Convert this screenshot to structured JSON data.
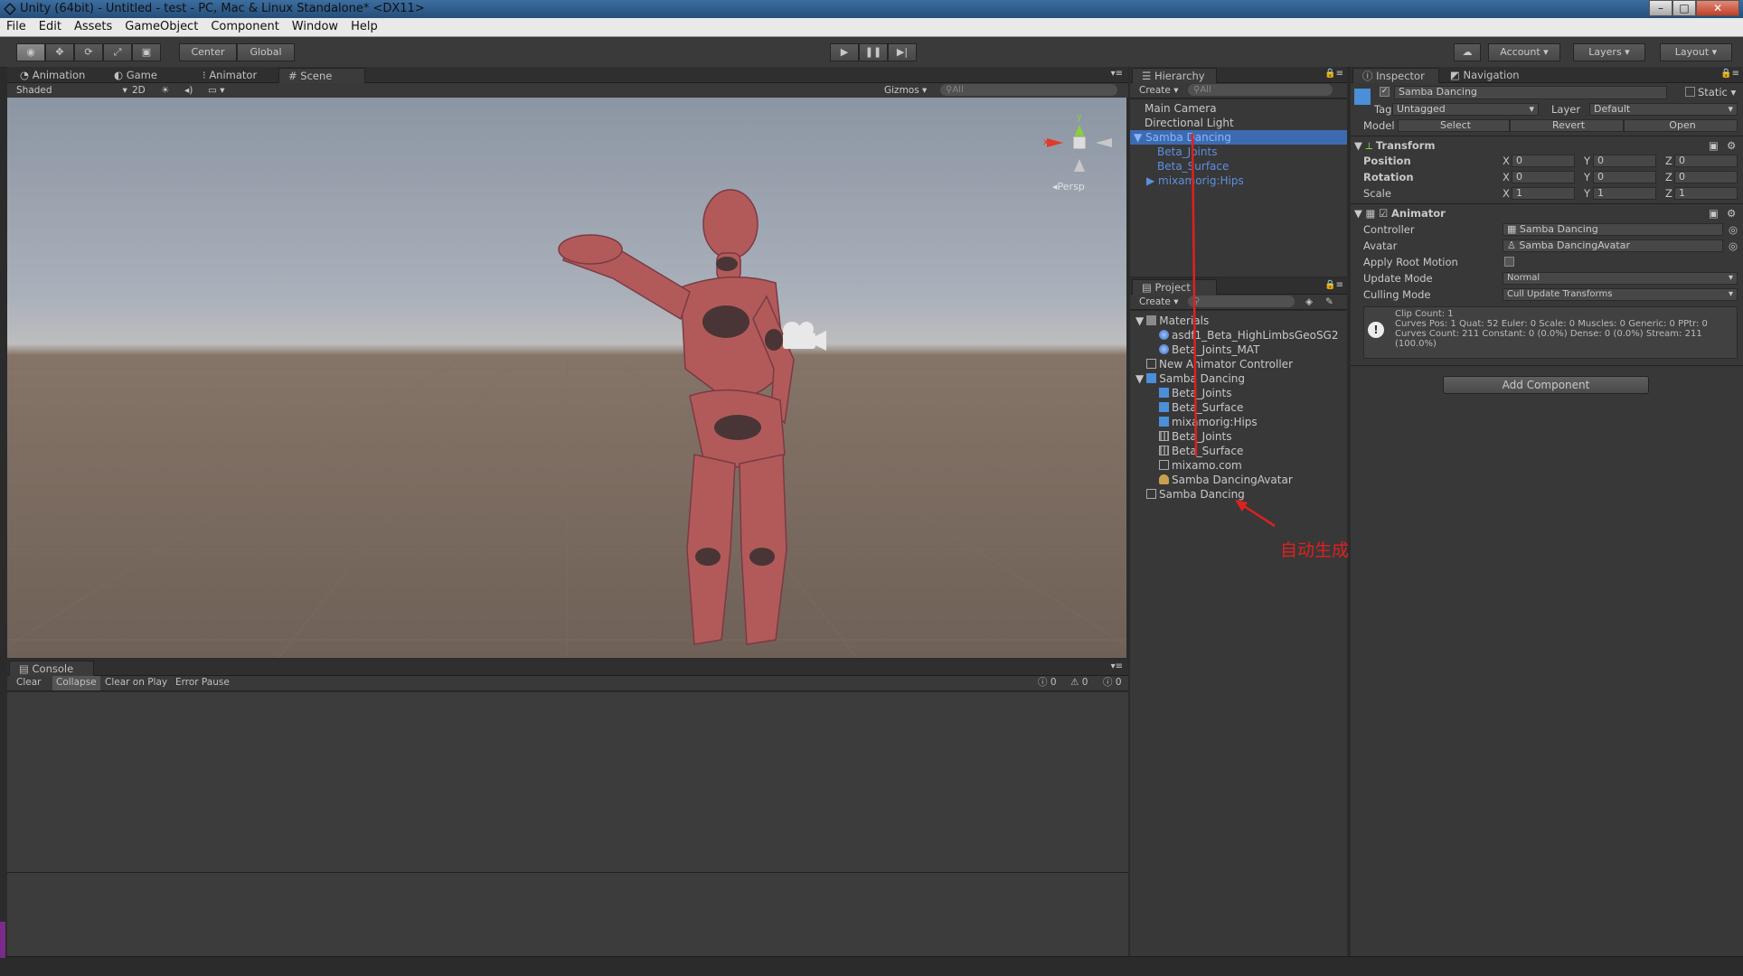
{
  "window": {
    "title": "Unity (64bit) - Untitled - test - PC, Mac & Linux Standalone* <DX11>"
  },
  "menu": [
    "File",
    "Edit",
    "Assets",
    "GameObject",
    "Component",
    "Window",
    "Help"
  ],
  "toolbar": {
    "center_label": "Center",
    "global_label": "Global",
    "account_label": "Account",
    "layers_label": "Layers",
    "layout_label": "Layout"
  },
  "scene_tabs": [
    "Animation",
    "Game",
    "Animator",
    "Scene"
  ],
  "scene_bar": {
    "shading": "Shaded",
    "mode2d": "2D",
    "gizmos": "Gizmos",
    "search_placeholder": "All",
    "persp": "Persp"
  },
  "gizmo_axes": {
    "x": "x",
    "y": "y"
  },
  "hierarchy": {
    "tab": "Hierarchy",
    "create": "Create",
    "search_placeholder": "All",
    "items": [
      "Main Camera",
      "Directional Light",
      "Samba Dancing",
      "Beta_Joints",
      "Beta_Surface",
      "mixamorig:Hips"
    ]
  },
  "project": {
    "tab": "Project",
    "create": "Create",
    "items": [
      "Materials",
      "asdf1_Beta_HighLimbsGeoSG2",
      "Beta_Joints_MAT",
      "New Animator Controller",
      "Samba Dancing",
      "Beta_Joints",
      "Beta_Surface",
      "mixamorig:Hips",
      "Beta_Joints",
      "Beta_Surface",
      "mixamo.com",
      "Samba DancingAvatar",
      "Samba Dancing"
    ]
  },
  "annotation": {
    "text": "自动生成",
    "color": "#e02020"
  },
  "inspector": {
    "tab": "Inspector",
    "nav_tab": "Navigation",
    "object_name": "Samba Dancing",
    "static_label": "Static",
    "tag_label": "Tag",
    "tag_value": "Untagged",
    "layer_label": "Layer",
    "layer_value": "Default",
    "model_label": "Model",
    "model_select": "Select",
    "model_revert": "Revert",
    "model_open": "Open",
    "transform": {
      "header": "Transform",
      "position_label": "Position",
      "rotation_label": "Rotation",
      "scale_label": "Scale",
      "position": [
        "0",
        "0",
        "0"
      ],
      "rotation": [
        "0",
        "0",
        "0"
      ],
      "scale": [
        "1",
        "1",
        "1"
      ],
      "axes": [
        "X",
        "Y",
        "Z"
      ]
    },
    "animator": {
      "header": "Animator",
      "controller_label": "Controller",
      "controller_value": "Samba Dancing",
      "avatar_label": "Avatar",
      "avatar_value": "Samba DancingAvatar",
      "apply_root_motion_label": "Apply Root Motion",
      "update_mode_label": "Update Mode",
      "update_mode_value": "Normal",
      "culling_mode_label": "Culling Mode",
      "culling_mode_value": "Cull Update Transforms",
      "info": [
        "Clip Count: 1",
        "Curves Pos: 1 Quat: 52 Euler: 0 Scale: 0 Muscles: 0 Generic: 0 PPtr: 0",
        "Curves Count: 211 Constant: 0 (0.0%) Dense: 0 (0.0%) Stream: 211",
        "(100.0%)"
      ]
    },
    "add_component": "Add Component"
  },
  "console": {
    "tab": "Console",
    "clear": "Clear",
    "collapse": "Collapse",
    "clear_on_play": "Clear on Play",
    "error_pause": "Error Pause",
    "counts": [
      "0",
      "0",
      "0"
    ]
  },
  "colors": {
    "selection": "#3d6bb0",
    "child_text": "#5d8fe0",
    "accent_red": "#e02020"
  }
}
